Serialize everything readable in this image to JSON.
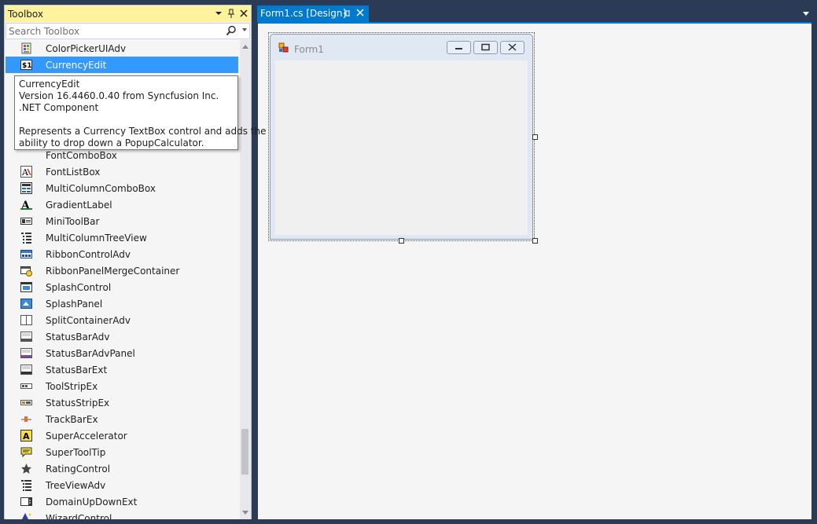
{
  "toolbox": {
    "title": "Toolbox",
    "search_placeholder": "Search Toolbox",
    "items": [
      {
        "label": "ColorPickerUIAdv",
        "icon": "color-picker-icon"
      },
      {
        "label": "CurrencyEdit",
        "icon": "currency-icon",
        "selected": true
      },
      {
        "label": "FontComboBox",
        "icon": "font-combo-icon"
      },
      {
        "label": "FontListBox",
        "icon": "font-list-icon"
      },
      {
        "label": "MultiColumnComboBox",
        "icon": "multicolumn-combo-icon"
      },
      {
        "label": "GradientLabel",
        "icon": "gradient-label-icon"
      },
      {
        "label": "MiniToolBar",
        "icon": "mini-toolbar-icon"
      },
      {
        "label": "MultiColumnTreeView",
        "icon": "multicolumn-tree-icon"
      },
      {
        "label": "RibbonControlAdv",
        "icon": "ribbon-icon"
      },
      {
        "label": "RibbonPanelMergeContainer",
        "icon": "ribbon-merge-icon"
      },
      {
        "label": "SplashControl",
        "icon": "splash-control-icon"
      },
      {
        "label": "SplashPanel",
        "icon": "splash-panel-icon"
      },
      {
        "label": "SplitContainerAdv",
        "icon": "split-container-icon"
      },
      {
        "label": "StatusBarAdv",
        "icon": "statusbar-icon"
      },
      {
        "label": "StatusBarAdvPanel",
        "icon": "statusbar-panel-icon"
      },
      {
        "label": "StatusBarExt",
        "icon": "statusbar-ext-icon"
      },
      {
        "label": "ToolStripEx",
        "icon": "toolstrip-icon"
      },
      {
        "label": "StatusStripEx",
        "icon": "statusstrip-icon"
      },
      {
        "label": "TrackBarEx",
        "icon": "trackbar-icon"
      },
      {
        "label": "SuperAccelerator",
        "icon": "super-accelerator-icon"
      },
      {
        "label": "SuperToolTip",
        "icon": "super-tooltip-icon"
      },
      {
        "label": "RatingControl",
        "icon": "star-icon"
      },
      {
        "label": "TreeViewAdv",
        "icon": "treeview-icon"
      },
      {
        "label": "DomainUpDownExt",
        "icon": "domain-updown-icon"
      },
      {
        "label": "WizardControl",
        "icon": "wizard-icon"
      }
    ],
    "tooltip": {
      "line1": "CurrencyEdit",
      "line2": "Version 16.4460.0.40 from Syncfusion Inc.",
      "line3": ".NET Component",
      "line4": "Represents a Currency TextBox control and adds the",
      "line5": "ability to drop down a PopupCalculator."
    }
  },
  "document": {
    "tab_label": "Form1.cs [Design]",
    "form_title": "Form1"
  },
  "colors": {
    "accent": "#007acc",
    "selection": "#3399ff",
    "toolbox_header": "#fff29d"
  }
}
